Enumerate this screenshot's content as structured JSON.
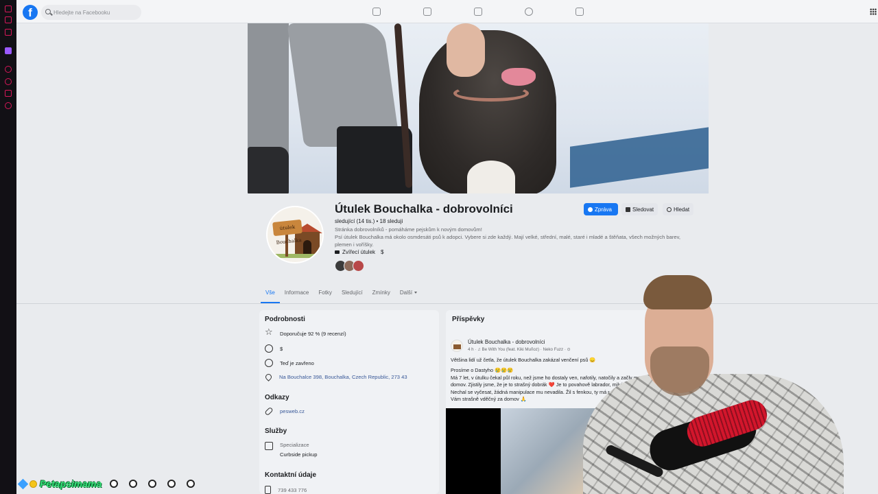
{
  "topbar": {
    "logo": "f",
    "search_placeholder": "Hledejte na Facebooku",
    "nav_icons": [
      "home-icon",
      "video-icon",
      "marketplace-icon",
      "groups-icon",
      "gaming-icon"
    ],
    "menu_icon": "grid-menu-icon"
  },
  "page": {
    "title": "Útulek Bouchalka - dobrovolníci",
    "followers": "sledující (14 tis.) • 18 sleduji",
    "description_line1": "Stránka dobrovolníků - pomáháme pejskům k novým domovům!",
    "description_line2": "Psí útulek Bouchalka má okolo osmdesáti psů k adopci. Vybere si zde každý. Mají velké, střední, malé, staré i mladé a štěňata, všech možných barev, plemen i voříšky.",
    "category": "Zvířecí útulek",
    "price": "$",
    "logo_text": "útulek Bouchalka",
    "friend_avatar_colors": [
      "#3b3b3b",
      "#8c6a5a",
      "#b84848"
    ]
  },
  "actions": {
    "message": "Zpráva",
    "follow": "Sledovat",
    "search": "Hledat"
  },
  "tabs": [
    {
      "label": "Vše",
      "active": true
    },
    {
      "label": "Informace"
    },
    {
      "label": "Fotky"
    },
    {
      "label": "Sledující"
    },
    {
      "label": "Zmínky"
    },
    {
      "label": "Další"
    }
  ],
  "details": {
    "heading": "Podrobnosti",
    "recommend": "Doporučuje 92 % (9 recenzí)",
    "price_range": "$",
    "hours": "Teď je zavřeno",
    "address": "Na Bouchalce 398, Bouchalka, Czech Republic, 273 43",
    "links_heading": "Odkazy",
    "website": "pesweb.cz",
    "services_heading": "Služby",
    "service_label": "Specializace",
    "service_value": "Curbside pickup",
    "contact_heading": "Kontaktní údaje",
    "phone": "739 433 776"
  },
  "posts": {
    "heading": "Příspěvky",
    "author": "Útulek Bouchalka - dobrovolníci",
    "meta": "4 h · ♫ Be With You (feat. Kiki Muñoz) · Neko Fuzz · ⊙",
    "line1": "Většina lidí už četla, že útulek Bouchalka zakázal venčení psů 😞",
    "line2": "Prosíme o Dastyho 😢😢😢",
    "line3": "Má 7 let, v útulku čekal půl roku, než jsme ho dostaly ven, nafotily, natočily a začly m",
    "line4": "domov. Zjistily jsme, že je to strašný dobrák ❤️ Je to povahově labrador, miluje",
    "line5": "Nechal se vyčesat, žádná manipulace mu nevadila. Žil s fenkou, ty má r",
    "line6": "Vám strašně vděčný za domov 🙏"
  },
  "stream": {
    "name": "Petapsimama"
  },
  "colors": {
    "accent": "#1877f2",
    "link": "#385898",
    "stream_name": "#38e07a",
    "sidebar": "#121015"
  }
}
